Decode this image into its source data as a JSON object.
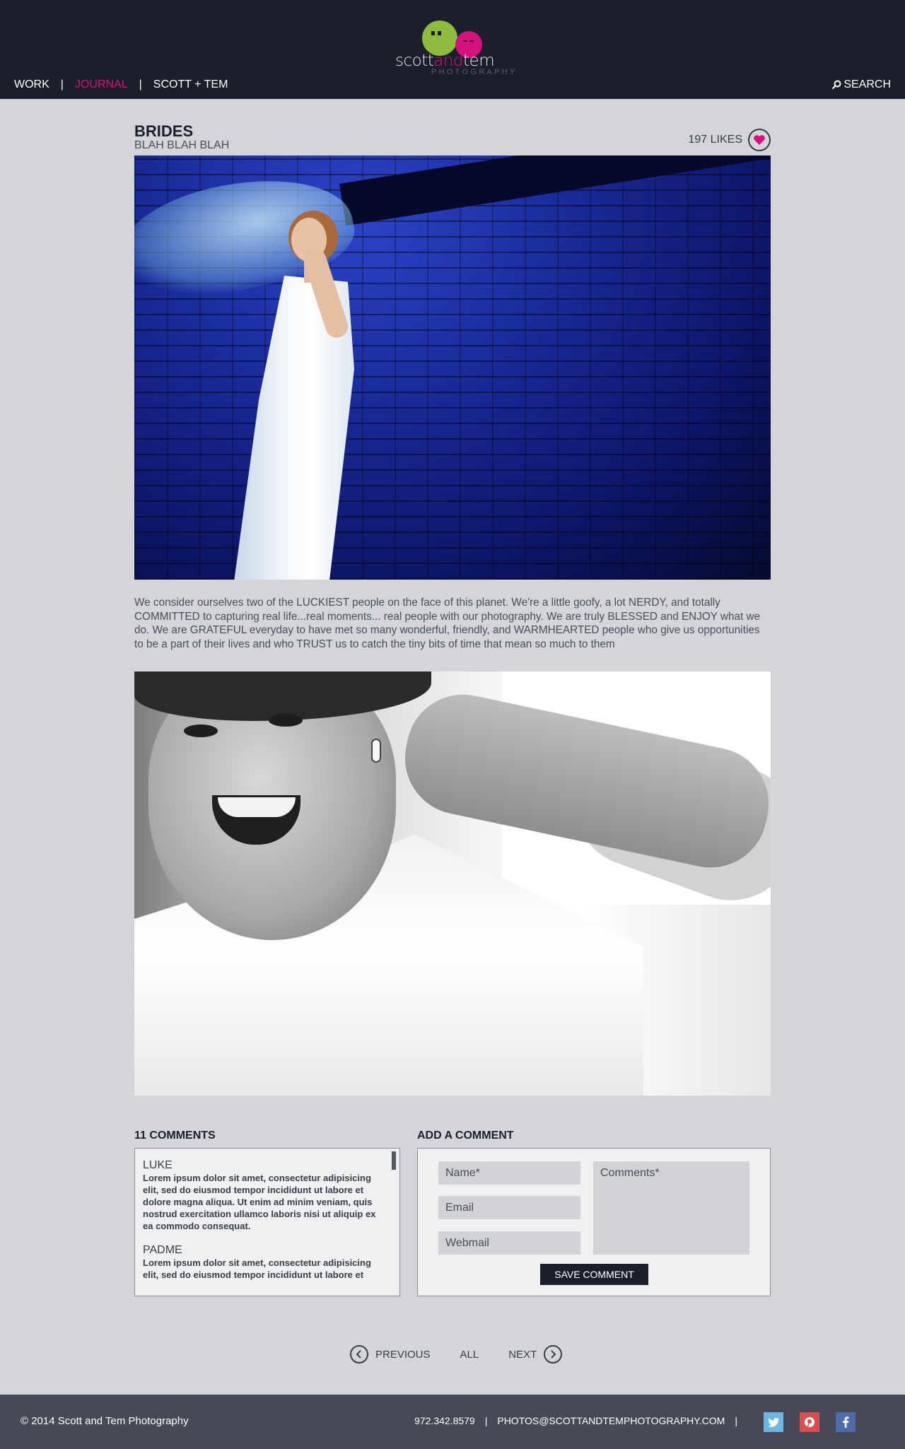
{
  "brand": {
    "word_part1": "scott",
    "word_part2": "and",
    "word_part3": "tem",
    "tagline": "PHOTOGRAPHY",
    "colors": {
      "green": "#8dbb3f",
      "pink": "#d4117f",
      "header": "#1c1f2b"
    }
  },
  "nav": {
    "items": [
      {
        "label": "WORK",
        "active": false
      },
      {
        "label": "JOURNAL",
        "active": true
      },
      {
        "label": "SCOTT + TEM",
        "active": false
      }
    ],
    "separator": "|",
    "search_label": "SEARCH",
    "search_icon": "magnifier-icon"
  },
  "post": {
    "title": "BRIDES",
    "subtitle": "BLAH BLAH BLAH",
    "likes_label": "197 LIKES",
    "like_icon": "heart-icon",
    "body": "We consider ourselves two of the LUCKIEST people on the face of this planet. We're a little goofy, a lot NERDY, and totally COMMITTED to capturing real life...real moments... real people with our photography. We are truly BLESSED and ENJOY what we do. We are GRATEFUL everyday to have met so many wonderful, friendly, and WARMHEARTED people who give us opportunities to be a part of their lives and who TRUST us to catch the tiny bits of time that mean so much to them"
  },
  "comments": {
    "heading": "11 COMMENTS",
    "items": [
      {
        "name": "LUKE",
        "text": "Lorem ipsum dolor sit amet, consectetur adipisicing elit, sed do eiusmod tempor incididunt ut labore et dolore magna aliqua. Ut enim ad minim veniam, quis nostrud exercitation ullamco laboris nisi ut aliquip ex ea commodo consequat."
      },
      {
        "name": "PADME",
        "text": "Lorem ipsum dolor sit amet, consectetur adipisicing elit, sed do eiusmod tempor incididunt ut labore et"
      }
    ]
  },
  "comment_form": {
    "heading": "ADD A COMMENT",
    "name_placeholder": "Name*",
    "email_placeholder": "Email",
    "webmail_placeholder": "Webmail",
    "comments_placeholder": "Comments*",
    "save_label": "SAVE COMMENT"
  },
  "pager": {
    "previous_label": "PREVIOUS",
    "all_label": "ALL",
    "next_label": "NEXT"
  },
  "footer": {
    "copyright": "© 2014 Scott and Tem Photography",
    "phone": "972.342.8579",
    "email": "PHOTOS@SCOTTANDTEMPHOTOGRAPHY.COM",
    "separator": "|",
    "social": [
      "twitter-icon",
      "pinterest-icon",
      "facebook-icon"
    ]
  }
}
